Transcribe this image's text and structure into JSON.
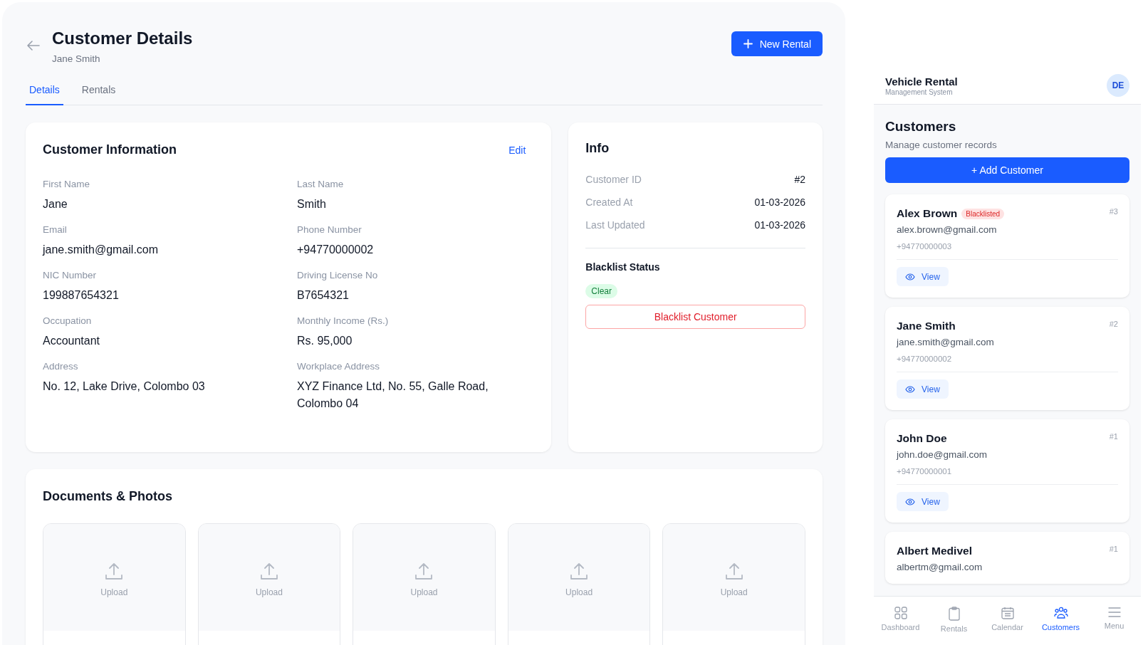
{
  "header": {
    "title": "Customer Details",
    "subtitle": "Jane Smith",
    "new_rental_button": "New Rental"
  },
  "tabs": [
    {
      "label": "Details",
      "selected": true
    },
    {
      "label": "Rentals",
      "selected": false
    }
  ],
  "customer_information": {
    "title": "Customer Information",
    "edit_link": "Edit",
    "fields": [
      {
        "label": "First Name",
        "value": "Jane"
      },
      {
        "label": "Last Name",
        "value": "Smith"
      },
      {
        "label": "Email",
        "value": "jane.smith@gmail.com"
      },
      {
        "label": "Phone Number",
        "value": "+94770000002"
      },
      {
        "label": "NIC Number",
        "value": "199887654321"
      },
      {
        "label": "Driving License No",
        "value": "B7654321"
      },
      {
        "label": "Occupation",
        "value": "Accountant"
      },
      {
        "label": "Monthly Income (Rs.)",
        "value": "Rs. 95,000"
      },
      {
        "label": "Address",
        "value": "No. 12, Lake Drive, Colombo 03"
      },
      {
        "label": "Workplace Address",
        "value": "XYZ Finance Ltd, No. 55, Galle Road, Colombo 04"
      }
    ]
  },
  "info": {
    "title": "Info",
    "rows": [
      {
        "label": "Customer ID",
        "value": "#2"
      },
      {
        "label": "Created At",
        "value": "01-03-2026"
      },
      {
        "label": "Last Updated",
        "value": "01-03-2026"
      }
    ],
    "blacklist_status": {
      "heading": "Blacklist Status",
      "status": "Clear",
      "blacklisted": false
    },
    "blacklist_button": "Blacklist Customer"
  },
  "documents": {
    "title": "Documents & Photos",
    "tiles": [
      {
        "label": "Upload"
      },
      {
        "label": "Upload"
      },
      {
        "label": "Upload"
      },
      {
        "label": "Upload"
      },
      {
        "label": "Upload"
      }
    ]
  },
  "app_header": {
    "title": "Vehicle Rental",
    "subtitle": "Management System",
    "avatar": "DE"
  },
  "customers_page": {
    "title": "Customers",
    "subtitle": "Manage customer records",
    "add_button": "+ Add Customer",
    "customers": [
      {
        "name": "Alex Brown",
        "badge": "Blacklisted",
        "id": "#3",
        "email": "alex.brown@gmail.com",
        "phone": "+94770000003",
        "action": "View"
      },
      {
        "name": "Jane Smith",
        "id": "#2",
        "email": "jane.smith@gmail.com",
        "phone": "+94770000002",
        "action": "View"
      },
      {
        "name": "John Doe",
        "id": "#1",
        "email": "john.doe@gmail.com",
        "phone": "+94770000001",
        "action": "View"
      },
      {
        "name": "Albert Medivel",
        "id": "#1",
        "email": "albertm@gmail.com"
      }
    ]
  },
  "bottom_nav": [
    {
      "label": "Dashboard",
      "selected": false
    },
    {
      "label": "Rentals",
      "selected": false
    },
    {
      "label": "Calendar",
      "selected": false
    },
    {
      "label": "Customers",
      "selected": true
    },
    {
      "label": "Menu",
      "selected": false
    }
  ]
}
